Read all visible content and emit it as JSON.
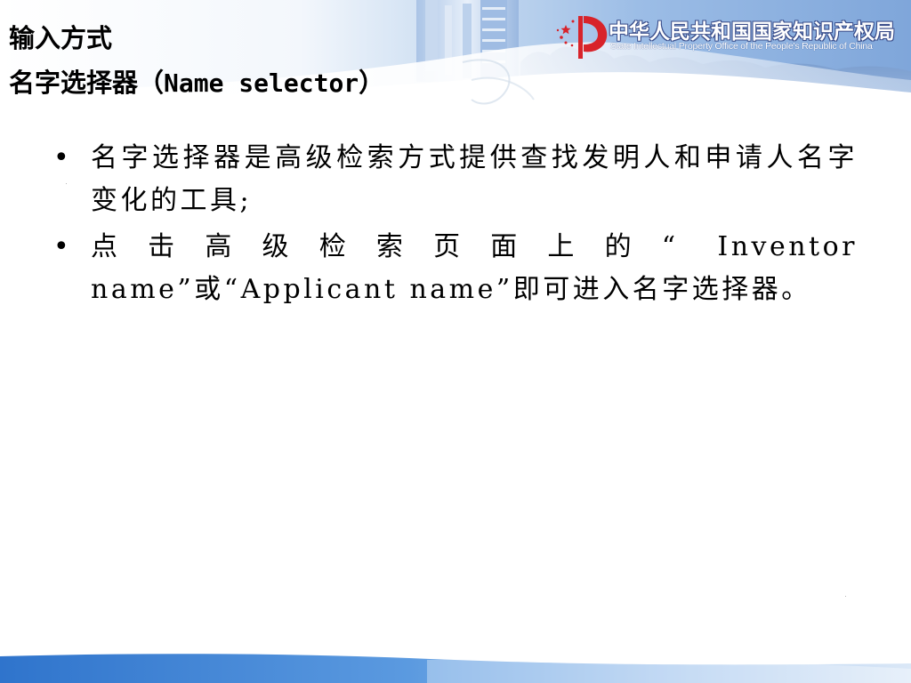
{
  "colors": {
    "banner_blue": "#8fb2de",
    "banner_light": "#dfe9f6",
    "footer_blue": "#3d7fd1",
    "logo_red": "#d8232a",
    "text": "#000000"
  },
  "icons": {
    "logo": "sipo-logo-icon",
    "bullet": "bullet-dot"
  },
  "header": {
    "title_line1": "输入方式",
    "title_line2_cn": "名字选择器（",
    "title_line2_en": "Name selector",
    "title_line2_close": "）",
    "logo_cn": "中华人民共和国国家知识产权局",
    "logo_en": "State Intellectual Property Office of the People's Republic of China"
  },
  "bullets": [
    {
      "text": "名字选择器是高级检索方式提供查找发明人和申请人名字变化的工具;"
    },
    {
      "text": "点击高级检索页面上的“ Inventor  name”或“Applicant name”即可进入名字选择器。"
    }
  ]
}
